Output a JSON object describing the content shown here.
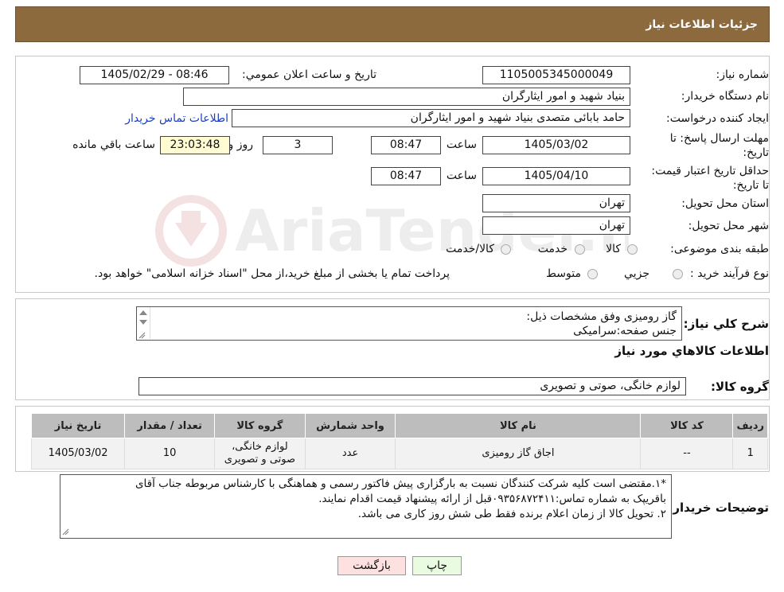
{
  "header": {
    "title": "جزئیات اطلاعات نیاز"
  },
  "info": {
    "need_number_label": "شماره نیاز:",
    "need_number": "1105005345000049",
    "announce_label": "تاریخ و ساعت اعلان عمومي:",
    "announce_value": "1405/02/29 - 08:46",
    "buyer_org_label": "نام دستگاه خريدار:",
    "buyer_org": "بنیاد شهید و امور ایثارگران",
    "requester_label": "ایجاد کننده درخواست:",
    "requester": "حامد بابائی متصدی بنیاد شهید و امور ایثارگران",
    "contact_link": "اطلاعات تماس خریدار",
    "deadline_label": "مهلت ارسال پاسخ: تا تاریخ:",
    "deadline_date": "1405/03/02",
    "time_label": "ساعت",
    "deadline_time": "08:47",
    "days_value": "3",
    "days_label": "روز و",
    "remaining_time": "23:03:48",
    "remaining_label": "ساعت باقي مانده",
    "validity_label": "حداقل تاریخ اعتبار قیمت: تا تاریخ:",
    "validity_date": "1405/04/10",
    "validity_time": "08:47",
    "province_label": "استان محل تحویل:",
    "province": "تهران",
    "city_label": "شهر محل تحویل:",
    "city": "تهران",
    "category_label": "طبقه بندی موضوعی:",
    "category_options": [
      "کالا",
      "خدمت",
      "کالا/خدمت"
    ],
    "process_label": "نوع فرآیند خرید :",
    "process_options": [
      "جزیي",
      "متوسط"
    ],
    "process_note": "پرداخت تمام یا بخشی از مبلغ خرید،از محل \"اسناد خزانه اسلامی\" خواهد بود."
  },
  "watermark": {
    "text": "AriaTender.neT"
  },
  "summary": {
    "label": "شرح کلي نياز:",
    "lines": [
      "گاز رومیزی وفق مشخصات ذیل:",
      "جنس صفحه:سرامیکی"
    ]
  },
  "goods_section": {
    "title": "اطلاعات کالاهاي مورد نياز",
    "group_label": "گروه کالا:",
    "group_value": "لوازم خانگی، صوتی و تصویری"
  },
  "table": {
    "headers": [
      "رديف",
      "کد کالا",
      "نام کالا",
      "واحد شمارش",
      "گروه کالا",
      "تعداد / مقدار",
      "تاریخ نیاز"
    ],
    "rows": [
      [
        "1",
        "--",
        "اجاق گاز رومیزی",
        "عدد",
        "لوازم خانگی، صوتی و تصویری",
        "10",
        "1405/03/02"
      ]
    ]
  },
  "buyer_notes": {
    "label": "توضیحات خریدار:",
    "lines": [
      "*۱.مقتضی است کلیه شرکت کنندگان نسبت به بارگزاری پیش فاکتور رسمی و هماهنگی با کارشناس مربوطه جناب آقای",
      "باقریپک به شماره تماس:۰۹۳۵۶۸۷۲۴۱۱قبل از ارائه پیشنهاد قیمت اقدام نمایند.",
      "۲. تحویل کالا از زمان اعلام برنده فقط طی شش روز کاری می باشد."
    ]
  },
  "buttons": {
    "print": "چاپ",
    "back": "بازگشت"
  }
}
